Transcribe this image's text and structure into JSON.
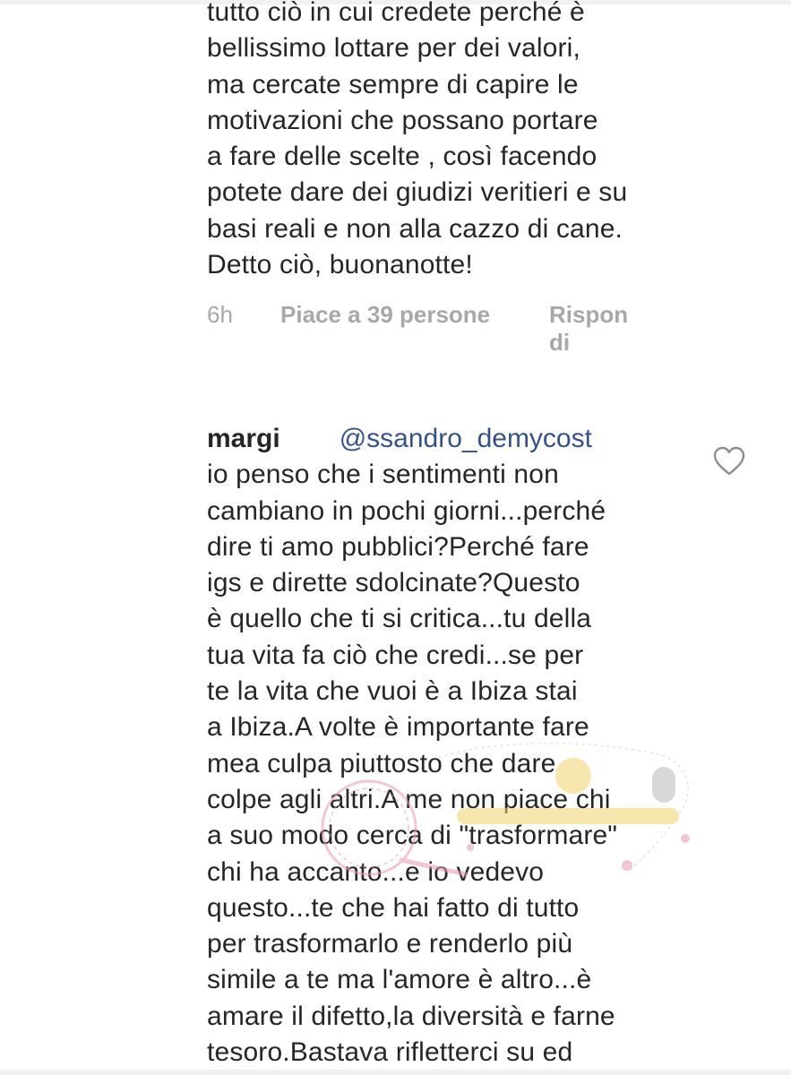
{
  "comments": [
    {
      "lines": [
        "tutto ciò in cui credete perché è",
        "bellissimo lottare per dei valori,",
        "ma cercate sempre di capire le",
        "motivazioni che possano portare",
        "a fare delle scelte , così facendo",
        "potete dare dei giudizi veritieri e su",
        "basi reali e non alla cazzo di cane.",
        "Detto ciò, buonanotte!"
      ],
      "time": "6h",
      "likes": "Piace a 39 persone",
      "reply": "Rispon di"
    },
    {
      "username": "margi",
      "mention": "@ssandro_demycost",
      "lines": [
        "io penso che i sentimenti non",
        "cambiano in pochi giorni...perché",
        "dire ti amo pubblici?Perché fare",
        "igs e dirette sdolcinate?Questo",
        "è quello che ti si critica...tu della",
        "tua vita fa ciò che credi...se per",
        "te la vita che vuoi è a Ibiza stai",
        "a Ibiza.A volte è importante fare",
        "mea culpa piuttosto che dare",
        "colpe agli altri.A me non piace chi",
        "a suo modo cerca di \"trasformare\"",
        "chi ha accanto...e io vedevo",
        "questo...te che hai fatto di tutto",
        "per trasformarlo e renderlo più",
        "simile a te ma l'amore è altro...è",
        "amare il difetto,la diversità e farne",
        "tesoro.Bastava rifletterci su ed"
      ]
    }
  ],
  "icons": {
    "like": "heart-outline-icon"
  },
  "colors": {
    "text": "#262626",
    "meta": "#a8a8a8",
    "mention": "#385185",
    "watermark_pink": "#e79ab6",
    "watermark_yellow": "#f2d26b"
  }
}
